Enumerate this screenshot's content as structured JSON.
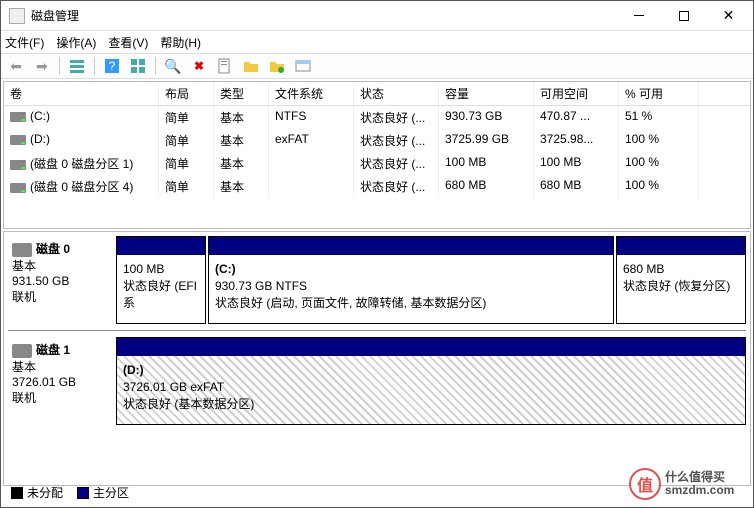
{
  "window": {
    "title": "磁盘管理"
  },
  "menu": {
    "file": "文件(F)",
    "action": "操作(A)",
    "view": "查看(V)",
    "help": "帮助(H)"
  },
  "columns": {
    "vol": "卷",
    "layout": "布局",
    "type": "类型",
    "fs": "文件系统",
    "status": "状态",
    "cap": "容量",
    "free": "可用空间",
    "pct": "% 可用"
  },
  "volumes": [
    {
      "name": "(C:)",
      "layout": "简单",
      "type": "基本",
      "fs": "NTFS",
      "status": "状态良好 (...",
      "cap": "930.73 GB",
      "free": "470.87 ...",
      "pct": "51 %"
    },
    {
      "name": "(D:)",
      "layout": "简单",
      "type": "基本",
      "fs": "exFAT",
      "status": "状态良好 (...",
      "cap": "3725.99 GB",
      "free": "3725.98...",
      "pct": "100 %"
    },
    {
      "name": "(磁盘 0 磁盘分区 1)",
      "layout": "简单",
      "type": "基本",
      "fs": "",
      "status": "状态良好 (...",
      "cap": "100 MB",
      "free": "100 MB",
      "pct": "100 %"
    },
    {
      "name": "(磁盘 0 磁盘分区 4)",
      "layout": "简单",
      "type": "基本",
      "fs": "",
      "status": "状态良好 (...",
      "cap": "680 MB",
      "free": "680 MB",
      "pct": "100 %"
    }
  ],
  "disks": {
    "disk0": {
      "name": "磁盘 0",
      "kind": "基本",
      "size": "931.50 GB",
      "state": "联机"
    },
    "disk1": {
      "name": "磁盘 1",
      "kind": "基本",
      "size": "3726.01 GB",
      "state": "联机"
    }
  },
  "parts": {
    "d0p1": {
      "size": "100 MB",
      "status": "状态良好 (EFI 系"
    },
    "d0p2": {
      "letter": "(C:)",
      "sizefs": "930.73 GB NTFS",
      "status": "状态良好 (启动, 页面文件, 故障转储, 基本数据分区)"
    },
    "d0p3": {
      "size": "680 MB",
      "status": "状态良好 (恢复分区)"
    },
    "d1p1": {
      "letter": "(D:)",
      "sizefs": "3726.01 GB exFAT",
      "status": "状态良好 (基本数据分区)"
    }
  },
  "legend": {
    "unalloc": "未分配",
    "primary": "主分区"
  },
  "watermark": {
    "char": "值",
    "line1": "什么值得买",
    "line2": "smzdm.com"
  }
}
